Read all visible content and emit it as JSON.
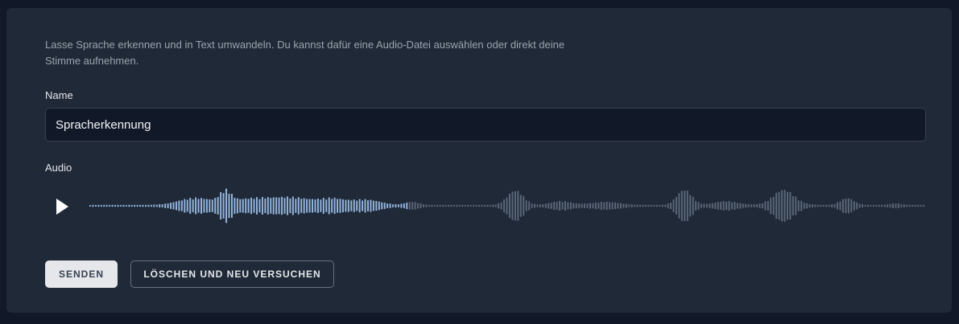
{
  "description": "Lasse Sprache erkennen und in Text umwandeln. Du kannst dafür eine Audio-Datei auswählen oder direkt deine Stimme aufnehmen.",
  "name_field": {
    "label": "Name",
    "value": "Spracherkennung"
  },
  "audio": {
    "label": "Audio",
    "play_icon": "play-icon",
    "played_fraction": 0.38,
    "played_color": "#93b4dc",
    "unplayed_color": "#5a6577"
  },
  "actions": {
    "send_label": "SENDEN",
    "reset_label": "LÖSCHEN UND NEU VERSUCHEN"
  }
}
